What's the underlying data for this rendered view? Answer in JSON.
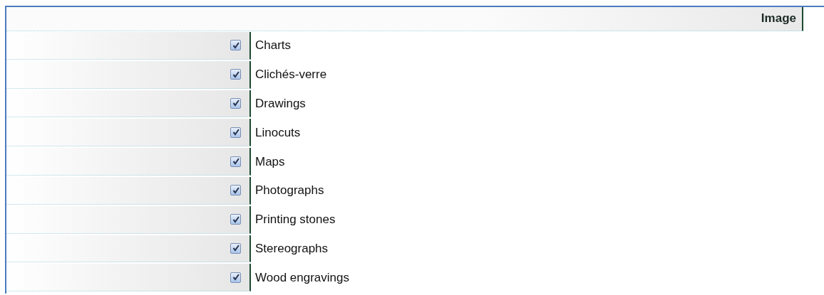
{
  "header": {
    "title": "Image"
  },
  "rows": [
    {
      "label": "Charts",
      "checked": true
    },
    {
      "label": "Clichés-verre",
      "checked": true
    },
    {
      "label": "Drawings",
      "checked": true
    },
    {
      "label": "Linocuts",
      "checked": true
    },
    {
      "label": "Maps",
      "checked": true
    },
    {
      "label": "Photographs",
      "checked": true
    },
    {
      "label": "Printing stones",
      "checked": true
    },
    {
      "label": "Stereographs",
      "checked": true
    },
    {
      "label": "Wood engravings",
      "checked": true
    }
  ]
}
